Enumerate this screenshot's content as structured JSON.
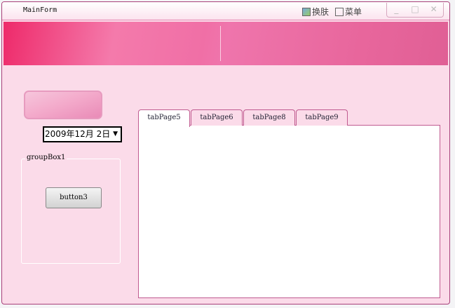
{
  "window": {
    "title": "MainForm",
    "skin_label": "换肤",
    "menu_label": "菜单",
    "minimize": "_",
    "maximize": "□",
    "close": "✕"
  },
  "date_picker": {
    "value": "2009年12月 2日",
    "arrow": "▼"
  },
  "group_box": {
    "label": "groupBox1",
    "button_label": "button3"
  },
  "tabs": [
    {
      "label": "tabPage5"
    },
    {
      "label": "tabPage6"
    },
    {
      "label": "tabPage8"
    },
    {
      "label": "tabPage9"
    }
  ],
  "colors": {
    "accent": "#f06fa6",
    "background": "#fbdbe9",
    "border": "#c05b90"
  }
}
